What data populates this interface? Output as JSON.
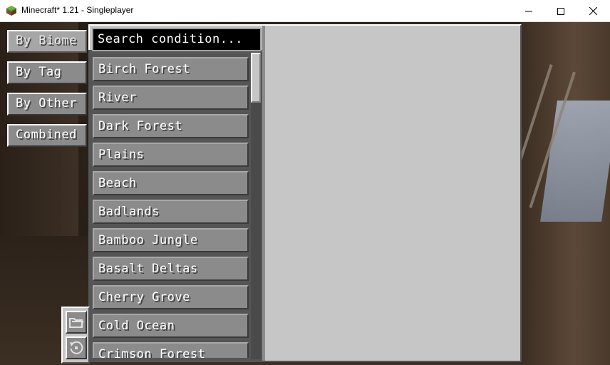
{
  "window": {
    "title": "Minecraft* 1.21 - Singleplayer",
    "minimize_icon": "minimize-icon",
    "maximize_icon": "maximize-icon",
    "close_icon": "close-icon"
  },
  "tabs": [
    {
      "label": "By Biome",
      "active": true
    },
    {
      "label": "By Tag",
      "active": false
    },
    {
      "label": "By Other",
      "active": false
    },
    {
      "label": "Combined",
      "active": false
    }
  ],
  "search": {
    "value": "Search condition..."
  },
  "list": {
    "items": [
      "Birch Forest",
      "River",
      "Dark Forest",
      "Plains",
      "Beach",
      "Badlands",
      "Bamboo Jungle",
      "Basalt Deltas",
      "Cherry Grove",
      "Cold Ocean",
      "Crimson Forest"
    ]
  },
  "side_buttons": [
    {
      "icon": "folder-icon"
    },
    {
      "icon": "reset-icon"
    }
  ],
  "colors": {
    "panel_bg": "#c6c6c6",
    "button_bg": "#8b8b8b",
    "list_bg": "#555555",
    "text": "#ffffff"
  }
}
